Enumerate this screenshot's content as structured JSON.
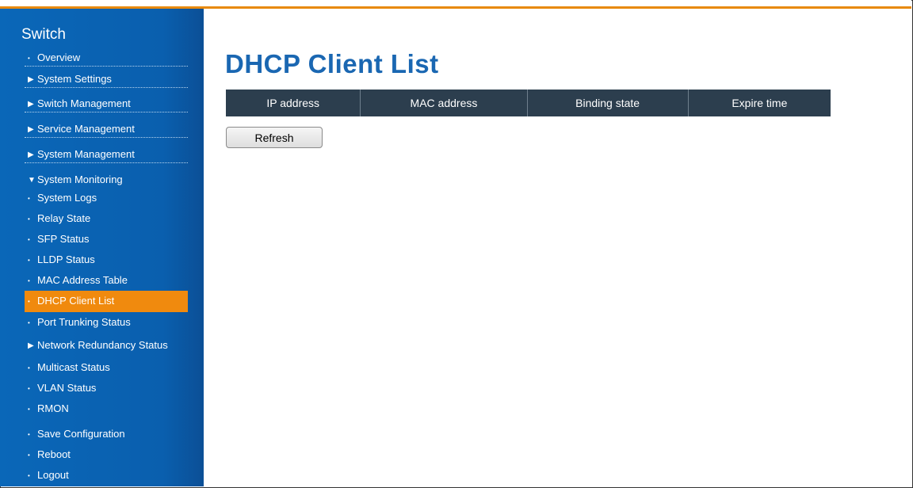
{
  "sidebar": {
    "title": "Switch",
    "items": [
      {
        "label": "Overview",
        "marker": "•"
      },
      {
        "label": "System Settings",
        "marker": "▶"
      },
      {
        "label": "Switch Management",
        "marker": "▶"
      },
      {
        "label": "Service Management",
        "marker": "▶"
      },
      {
        "label": "System Management",
        "marker": "▶"
      },
      {
        "label": "System Monitoring",
        "marker": "▼"
      },
      {
        "label": "System Logs",
        "marker": "•"
      },
      {
        "label": "Relay State",
        "marker": "•"
      },
      {
        "label": "SFP Status",
        "marker": "•"
      },
      {
        "label": "LLDP Status",
        "marker": "•"
      },
      {
        "label": "MAC Address Table",
        "marker": "•"
      },
      {
        "label": "DHCP Client List",
        "marker": "•"
      },
      {
        "label": "Port Trunking Status",
        "marker": "•"
      },
      {
        "label": "Network Redundancy Status",
        "marker": "▶"
      },
      {
        "label": "Multicast Status",
        "marker": "•"
      },
      {
        "label": "VLAN Status",
        "marker": "•"
      },
      {
        "label": "RMON",
        "marker": "•"
      },
      {
        "label": "Save Configuration",
        "marker": "•"
      },
      {
        "label": "Reboot",
        "marker": "•"
      },
      {
        "label": "Logout",
        "marker": "•"
      }
    ]
  },
  "main": {
    "title": "DHCP Client List",
    "table": {
      "columns": [
        "IP address",
        "MAC address",
        "Binding state",
        "Expire time"
      ],
      "rows": []
    },
    "refresh_label": "Refresh"
  },
  "colors": {
    "sidebar_bg": "#0a67b8",
    "active_item": "#f08a0e",
    "title": "#1a67b2",
    "table_header": "#2c3e4e",
    "top_accent": "#e8890c"
  }
}
